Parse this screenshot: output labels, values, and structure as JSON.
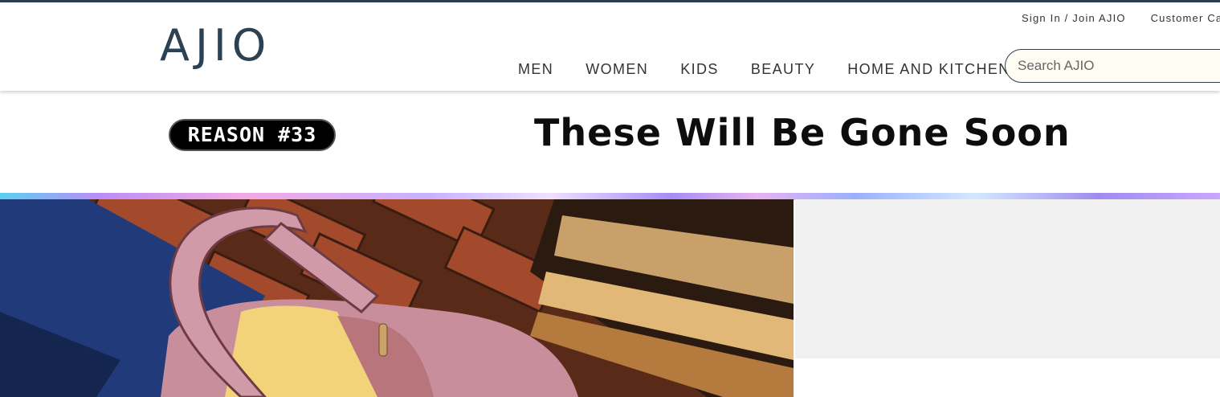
{
  "header": {
    "logo": "AJIO",
    "util_links": [
      "Sign In / Join AJIO",
      "Customer Care"
    ],
    "nav": [
      "MEN",
      "WOMEN",
      "KIDS",
      "BEAUTY",
      "HOME AND KITCHEN"
    ],
    "search_placeholder": "Search AJIO"
  },
  "banner": {
    "badge": "REASON #33",
    "title": "These Will Be Gone Soon"
  },
  "colors": {
    "brand": "#2c4152",
    "top_rule": "#2c3e50",
    "side_panel": "#f0f0f0"
  }
}
